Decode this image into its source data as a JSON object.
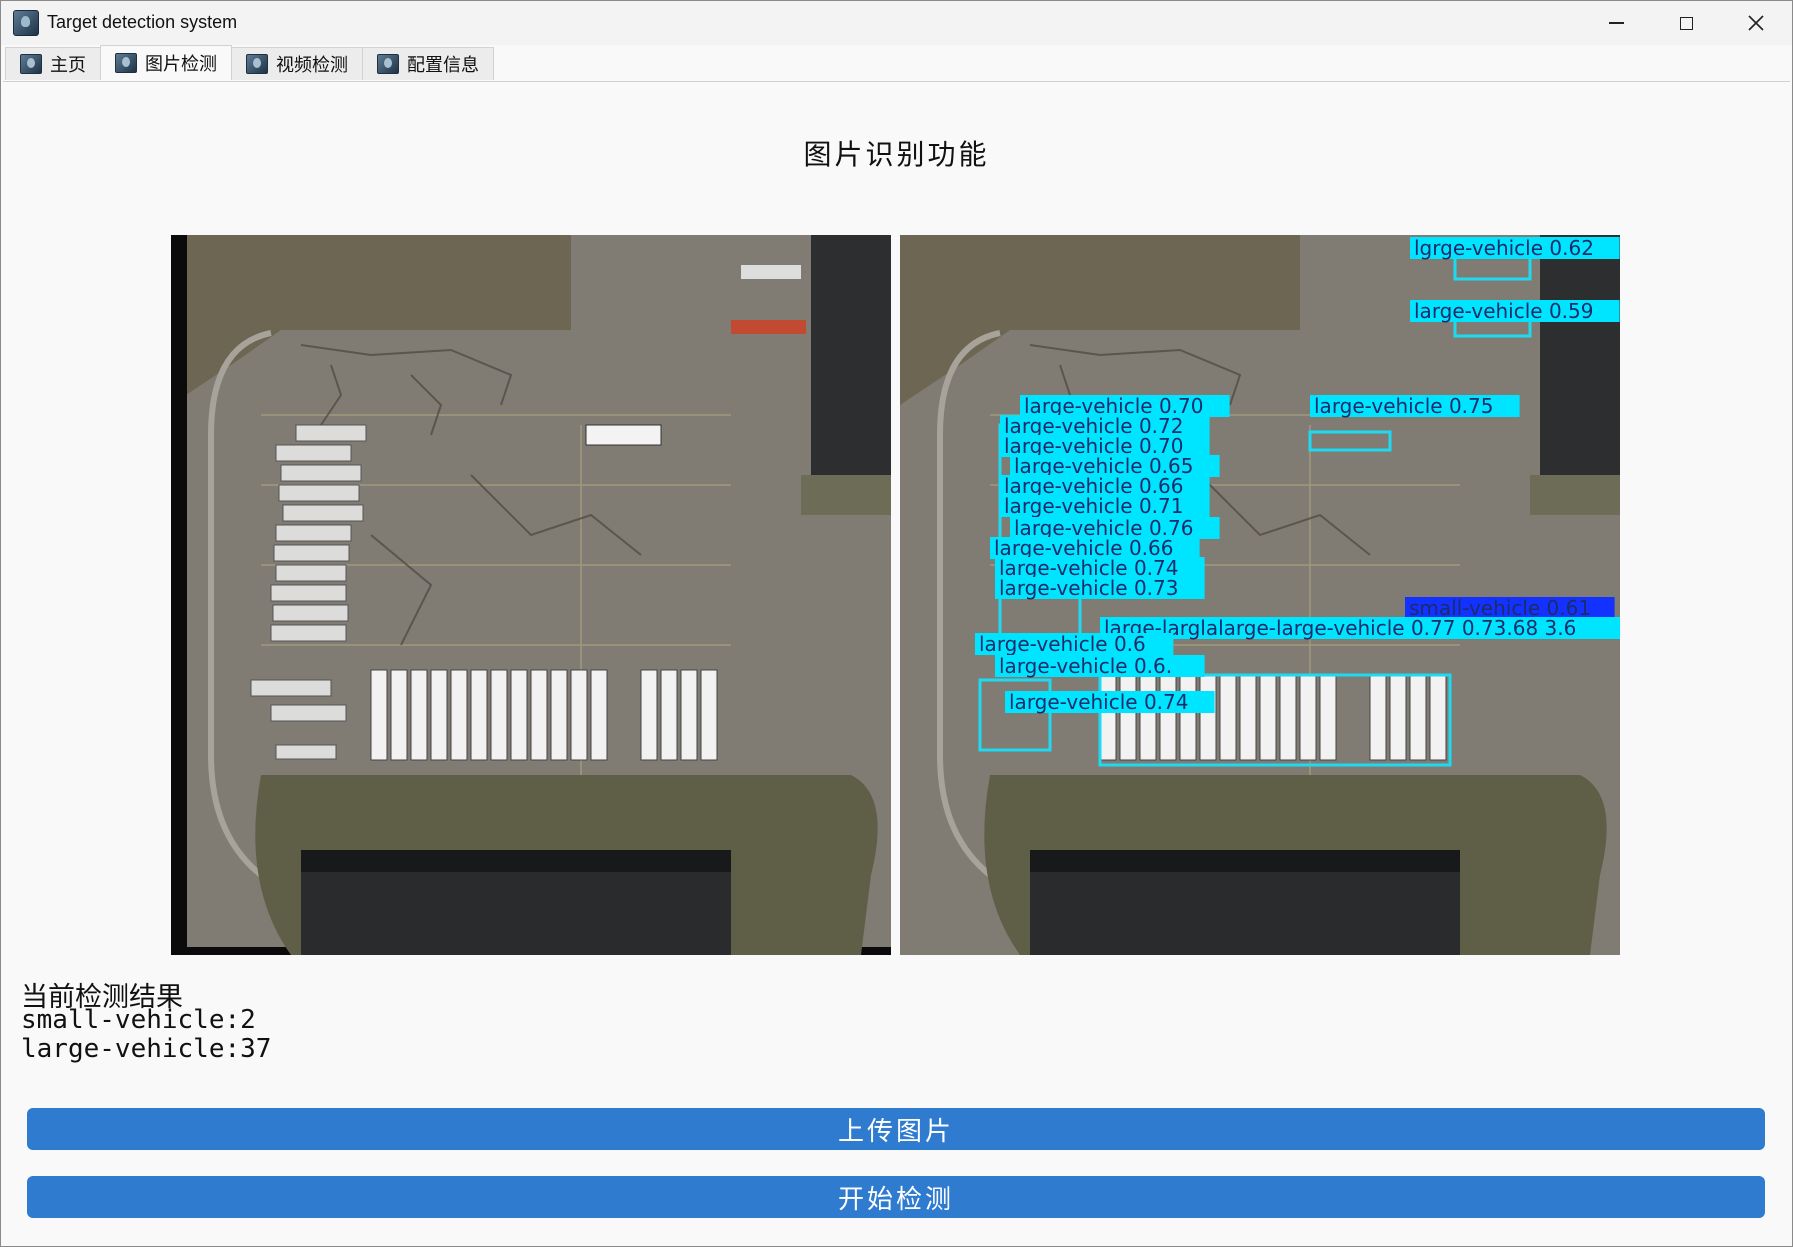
{
  "window": {
    "title": "Target detection system"
  },
  "tabs": [
    {
      "label": "主页",
      "active": false
    },
    {
      "label": "图片检测",
      "active": true
    },
    {
      "label": "视频检测",
      "active": false
    },
    {
      "label": "配置信息",
      "active": false
    }
  ],
  "page": {
    "heading": "图片识别功能"
  },
  "images": {
    "original_alt": "aerial parking lot image",
    "result_alt": "aerial parking lot image with detections"
  },
  "detections": {
    "label_color": "#00e5ff",
    "small_color": "#1432ff",
    "labels": [
      "lgrge-vehicle 0.62",
      "large-vehicle 0.59",
      "large-vehicle 0.70",
      "large-vehicle 0.75",
      "large-vehicle 0.72",
      "large-vehicle 0.70",
      "large-vehicle 0.65",
      "large-vehicle 0.66",
      "large-vehicle 0.71",
      "large-vehicle 0.76",
      "large-vehicle 0.66",
      "large-vehicle 0.74",
      "large-vehicle 0.73",
      "small-vehicle 0.61",
      "large-larglalarge-large-vehicle 0.77 0.73.68 3.6",
      "large-vehicle 0.6",
      "large-vehicle 0.6.",
      "large-vehicle 0.74"
    ]
  },
  "results": {
    "title": "当前检测结果",
    "small_vehicle": "small-vehicle:2",
    "large_vehicle": "large-vehicle:37"
  },
  "buttons": {
    "upload": "上传图片",
    "detect": "开始检测"
  },
  "colors": {
    "accent": "#2f7bd0"
  }
}
